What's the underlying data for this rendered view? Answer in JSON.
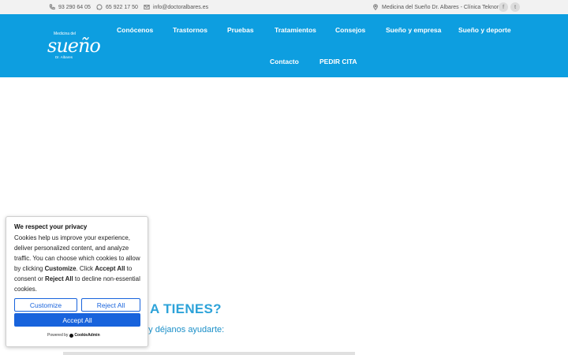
{
  "topbar": {
    "phone1": "93 290 64 05",
    "phone2": "65 922 17 50",
    "email": "info@doctoralbares.es",
    "location": "Medicina del Sueño Dr. Albares - Clínica Teknon",
    "social": [
      "f",
      "t"
    ]
  },
  "header": {
    "logo": {
      "line1": "Medicina del",
      "line2": "sueño",
      "line3": "Dr. Albares"
    },
    "nav": [
      "Conócenos",
      "Trastornos",
      "Pruebas",
      "Tratamientos",
      "Consejos",
      "Sueño y empresa",
      "Sueño y deporte",
      "Contacto",
      "PEDIR CITA"
    ]
  },
  "main": {
    "headline": "A TIENES?",
    "subline": "e y déjanos ayudarte:"
  },
  "cookie": {
    "title": "We respect your privacy",
    "text_a": "Cookies help us improve your experience, deliver personalized content, and analyze traffic. You can choose which cookies to allow by clicking ",
    "text_customize": "Customize",
    "text_b": ". Click ",
    "text_accept": "Accept All",
    "text_c": " to consent or ",
    "text_reject": "Reject All",
    "text_d": " to decline non-essential cookies.",
    "customize_label": "Customize",
    "reject_label": "Reject All",
    "accept_label": "Accept All",
    "powered_by": "Powered by",
    "powered_brand": "CookieAdmin"
  },
  "colors": {
    "header_bg": "#0d9ee0",
    "topbar_bg": "#f2f2f2",
    "accent_button": "#1863dc",
    "headline": "#2da3d9"
  }
}
